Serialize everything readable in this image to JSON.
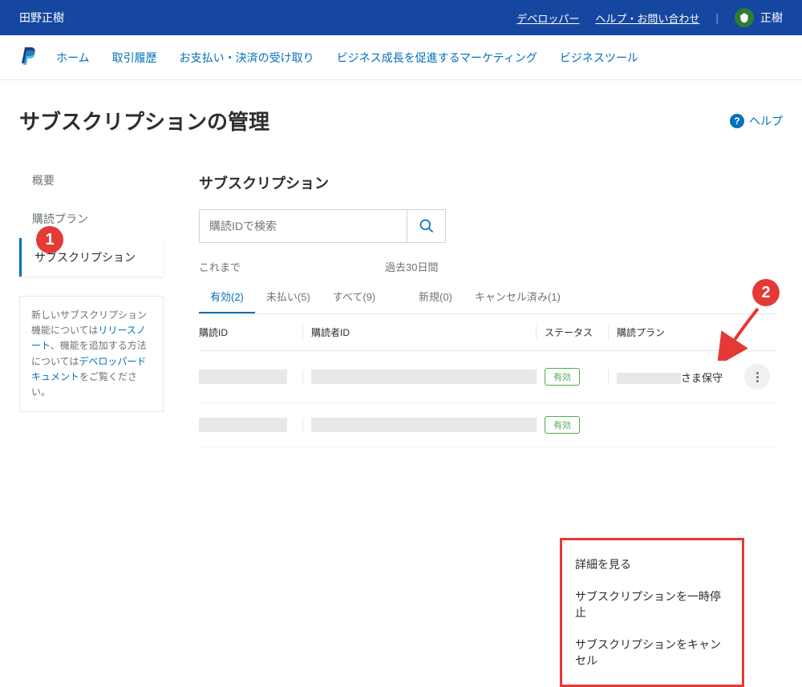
{
  "header": {
    "account_name": "田野正樹",
    "developer_link": "デベロッパー",
    "help_link": "ヘルプ・お問い合わせ",
    "user_name": "正樹"
  },
  "nav": {
    "items": [
      "ホーム",
      "取引履歴",
      "お支払い・決済の受け取り",
      "ビジネス成長を促進するマーケティング",
      "ビジネスツール"
    ]
  },
  "page": {
    "title": "サブスクリプションの管理",
    "help_label": "ヘルプ"
  },
  "sidebar": {
    "items": [
      {
        "label": "概要",
        "active": false
      },
      {
        "label": "購読プラン",
        "active": false
      },
      {
        "label": "サブスクリプション",
        "active": true
      }
    ],
    "note_prefix": "新しいサブスクリプション機能については",
    "note_link1": "リリースノート",
    "note_mid": "、機能を追加する方法については",
    "note_link2": "デベロッパードキュメント",
    "note_suffix": "をご覧ください。"
  },
  "main": {
    "section_title": "サブスクリプション",
    "search_placeholder": "購読IDで検索",
    "tabs_header_left": "これまで",
    "tabs_header_right": "過去30日間",
    "tabs_left": [
      {
        "label": "有効(2)",
        "active": true
      },
      {
        "label": "未払い(5)",
        "active": false
      },
      {
        "label": "すべて(9)",
        "active": false
      }
    ],
    "tabs_right": [
      {
        "label": "新規(0)",
        "active": false
      },
      {
        "label": "キャンセル済み(1)",
        "active": false
      }
    ],
    "columns": {
      "sub_id": "購読ID",
      "buyer_id": "購読者ID",
      "status": "ステータス",
      "plan": "購読プラン"
    },
    "rows": [
      {
        "status": "有効",
        "plan_suffix": "さま保守"
      },
      {
        "status": "有効",
        "plan_suffix": ""
      }
    ],
    "dropdown": {
      "view": "詳細を見る",
      "pause": "サブスクリプションを一時停止",
      "cancel": "サブスクリプションをキャンセル"
    }
  },
  "annotations": {
    "badge1": "1",
    "badge2": "2"
  }
}
